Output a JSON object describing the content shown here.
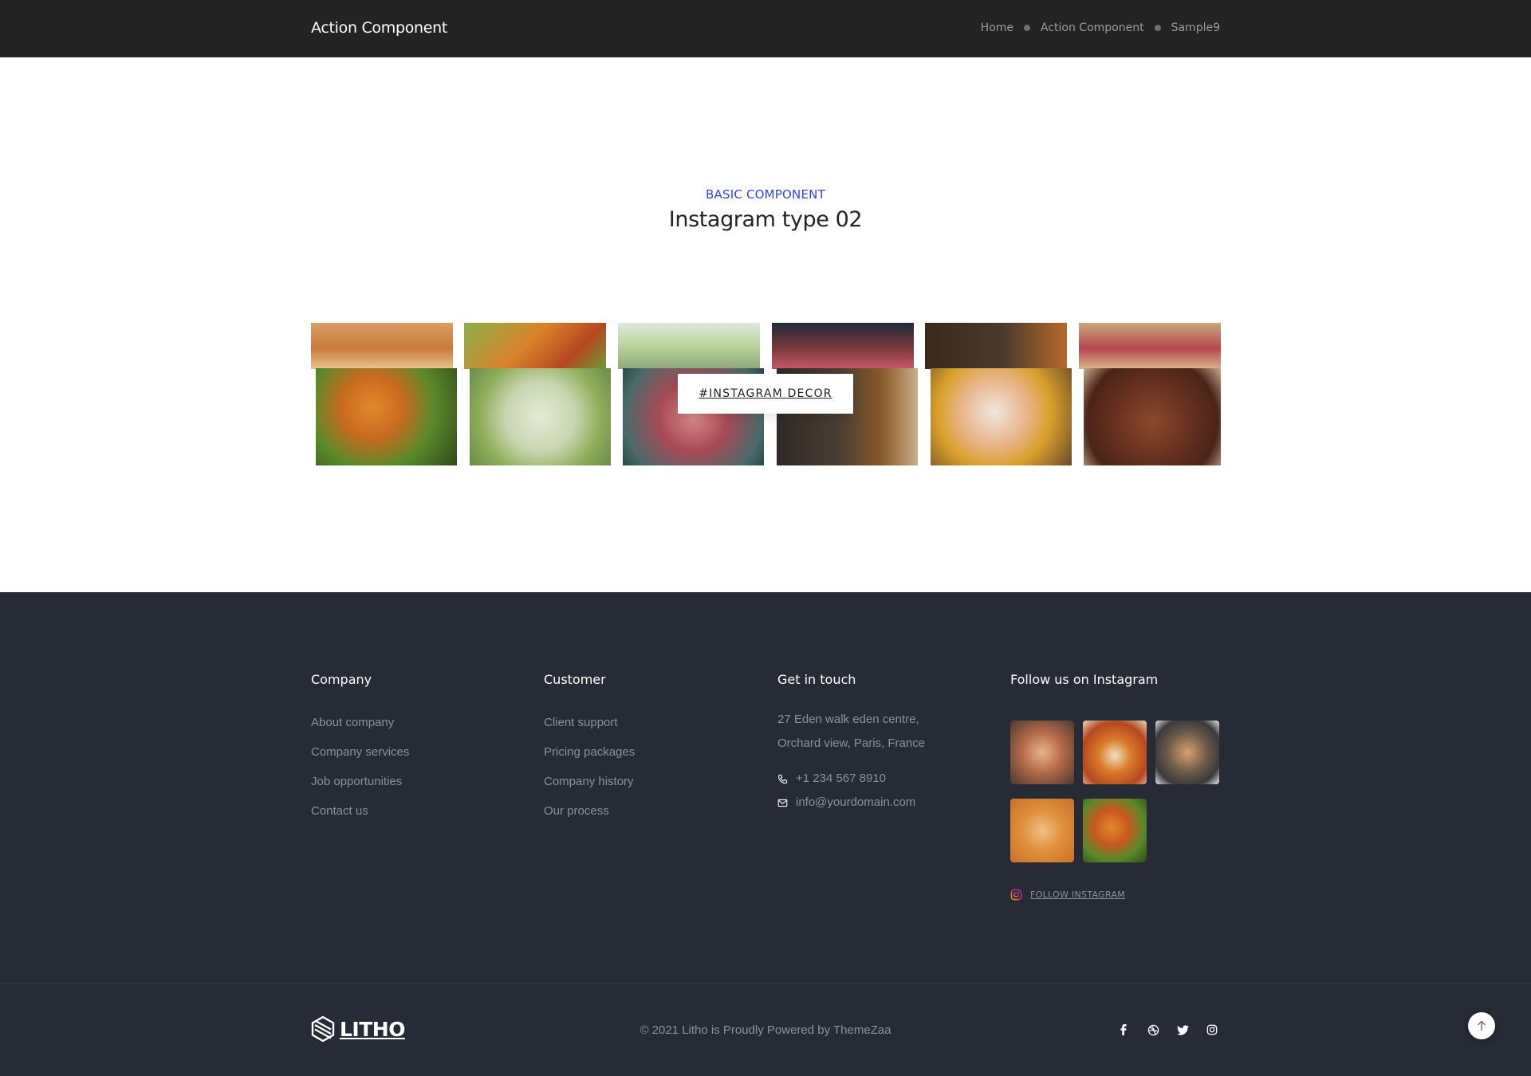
{
  "header": {
    "title": "Action Component",
    "breadcrumbs": [
      "Home",
      "Action Component",
      "Sample9"
    ]
  },
  "section": {
    "eyebrow": "BASIC COMPONENT",
    "heading": "Instagram type 02",
    "tag_label": "#INSTAGRAM DECOR"
  },
  "footer": {
    "company": {
      "title": "Company",
      "links": [
        "About company",
        "Company services",
        "Job opportunities",
        "Contact us"
      ]
    },
    "customer": {
      "title": "Customer",
      "links": [
        "Client support",
        "Pricing packages",
        "Company history",
        "Our process"
      ]
    },
    "contact": {
      "title": "Get in touch",
      "address_line1": "27 Eden walk eden centre,",
      "address_line2": "Orchard view, Paris, France",
      "phone": "+1 234 567 8910",
      "email": "info@yourdomain.com"
    },
    "instagram": {
      "title": "Follow us on Instagram",
      "follow_label": "FOLLOW INSTAGRAM"
    },
    "brand": "LITHO",
    "copyright": "© 2021 Litho is Proudly Powered by ThemeZaa",
    "social_icons": [
      "facebook-icon",
      "dribbble-icon",
      "twitter-icon",
      "instagram-icon"
    ]
  },
  "colors": {
    "header_bg": "#232323",
    "accent": "#2946f3",
    "footer_bg": "#262b35",
    "footer_text": "#8b909b"
  }
}
